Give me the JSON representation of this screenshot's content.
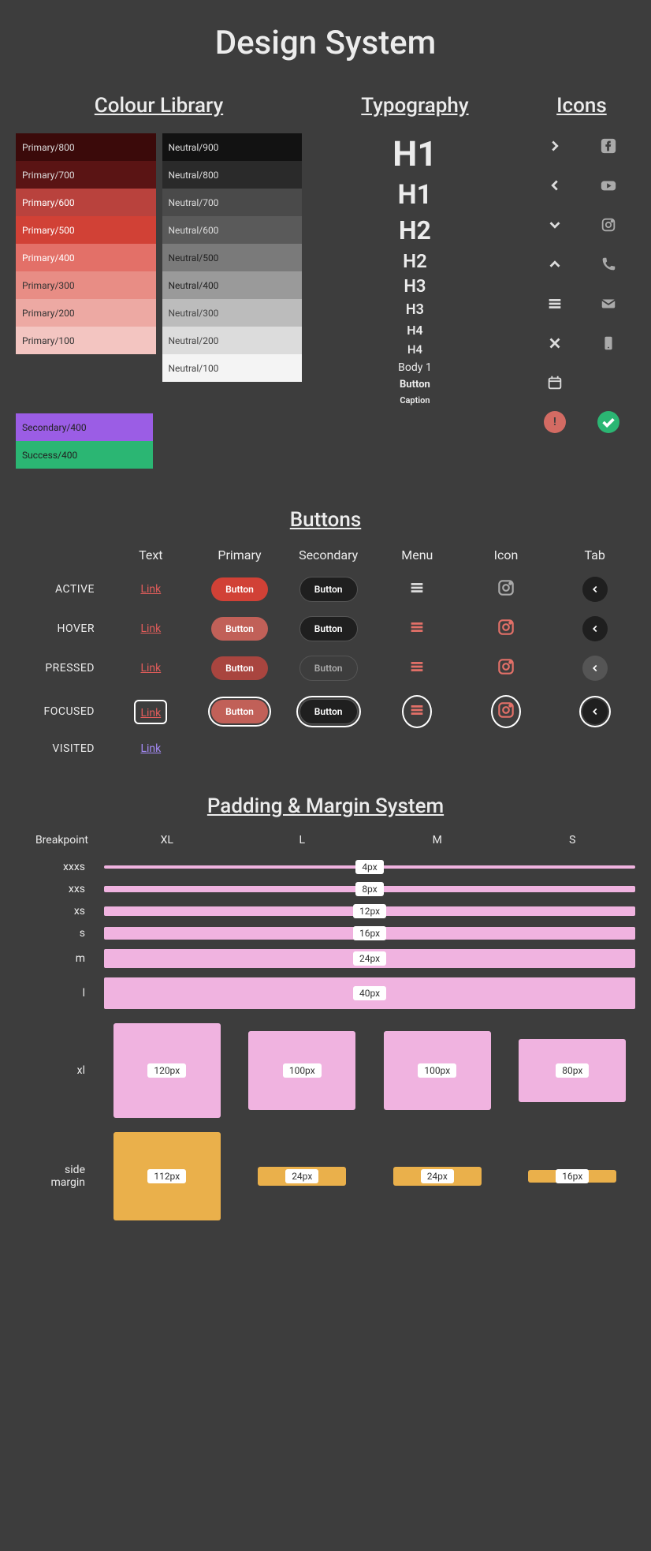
{
  "title": "Design System",
  "sections": {
    "colour": "Colour Library",
    "typography": "Typography",
    "icons": "Icons",
    "buttons": "Buttons",
    "spacing": "Padding & Margin System"
  },
  "colours": {
    "primary": [
      {
        "label": "Primary/800",
        "bg": "#3b0a0a",
        "fg": "#ddd"
      },
      {
        "label": "Primary/700",
        "bg": "#5a1414",
        "fg": "#ddd"
      },
      {
        "label": "Primary/600",
        "bg": "#b9423d",
        "fg": "#fff"
      },
      {
        "label": "Primary/500",
        "bg": "#d14136",
        "fg": "#fff"
      },
      {
        "label": "Primary/400",
        "bg": "#e37068",
        "fg": "#fff"
      },
      {
        "label": "Primary/300",
        "bg": "#e88d85",
        "fg": "#333"
      },
      {
        "label": "Primary/200",
        "bg": "#eda9a3",
        "fg": "#333"
      },
      {
        "label": "Primary/100",
        "bg": "#f3c5c1",
        "fg": "#333"
      }
    ],
    "neutral": [
      {
        "label": "Neutral/900",
        "bg": "#121212",
        "fg": "#ddd"
      },
      {
        "label": "Neutral/800",
        "bg": "#2a2a2a",
        "fg": "#ddd"
      },
      {
        "label": "Neutral/700",
        "bg": "#4a4a4a",
        "fg": "#ddd"
      },
      {
        "label": "Neutral/600",
        "bg": "#5a5a5a",
        "fg": "#ddd"
      },
      {
        "label": "Neutral/500",
        "bg": "#7a7a7a",
        "fg": "#222"
      },
      {
        "label": "Neutral/400",
        "bg": "#9a9a9a",
        "fg": "#222"
      },
      {
        "label": "Neutral/300",
        "bg": "#bcbcbc",
        "fg": "#444"
      },
      {
        "label": "Neutral/200",
        "bg": "#dcdcdc",
        "fg": "#444"
      },
      {
        "label": "Neutral/100",
        "bg": "#f4f4f4",
        "fg": "#444"
      }
    ],
    "extra": [
      {
        "label": "Secondary/400",
        "bg": "#9b5de5",
        "fg": "#222"
      },
      {
        "label": "Success/400",
        "bg": "#2bb673",
        "fg": "#222"
      }
    ]
  },
  "typography_items": [
    {
      "text": "H1",
      "size": "44px",
      "weight": "700"
    },
    {
      "text": "H1",
      "size": "34px",
      "weight": "700"
    },
    {
      "text": "H2",
      "size": "32px",
      "weight": "700"
    },
    {
      "text": "H2",
      "size": "24px",
      "weight": "600"
    },
    {
      "text": "H3",
      "size": "22px",
      "weight": "600"
    },
    {
      "text": "H3",
      "size": "18px",
      "weight": "600"
    },
    {
      "text": "H4",
      "size": "16px",
      "weight": "600"
    },
    {
      "text": "H4",
      "size": "15px",
      "weight": "500"
    },
    {
      "text": "Body 1",
      "size": "14px",
      "weight": "400"
    },
    {
      "text": "Button",
      "size": "13px",
      "weight": "700"
    },
    {
      "text": "Caption",
      "size": "11px",
      "weight": "600"
    }
  ],
  "icon_names": [
    "chevron-right",
    "facebook",
    "chevron-left",
    "youtube",
    "chevron-down",
    "instagram",
    "chevron-up",
    "phone",
    "menu",
    "mail",
    "close",
    "smartphone",
    "calendar",
    "",
    "error",
    "success"
  ],
  "button_cols": [
    "Text",
    "Primary",
    "Secondary",
    "Menu",
    "Icon",
    "Tab"
  ],
  "button_rows": [
    "ACTIVE",
    "HOVER",
    "PRESSED",
    "FOCUSED",
    "VISITED"
  ],
  "button_labels": {
    "link": "Link",
    "button": "Button"
  },
  "spacing": {
    "breakpoint_label": "Breakpoint",
    "breakpoints": [
      "XL",
      "L",
      "M",
      "S"
    ],
    "sizes": [
      {
        "name": "xxxs",
        "px": "4px",
        "h": 4
      },
      {
        "name": "xxs",
        "px": "8px",
        "h": 8
      },
      {
        "name": "xs",
        "px": "12px",
        "h": 12
      },
      {
        "name": "s",
        "px": "16px",
        "h": 16
      },
      {
        "name": "m",
        "px": "24px",
        "h": 24
      },
      {
        "name": "l",
        "px": "40px",
        "h": 40
      }
    ],
    "xl_row": {
      "name": "xl",
      "values": [
        "120px",
        "100px",
        "100px",
        "80px"
      ],
      "heights": [
        120,
        100,
        100,
        80
      ]
    },
    "margin_row": {
      "name": "side margin",
      "values": [
        "112px",
        "24px",
        "24px",
        "16px"
      ],
      "heights": [
        112,
        24,
        24,
        16
      ]
    }
  }
}
